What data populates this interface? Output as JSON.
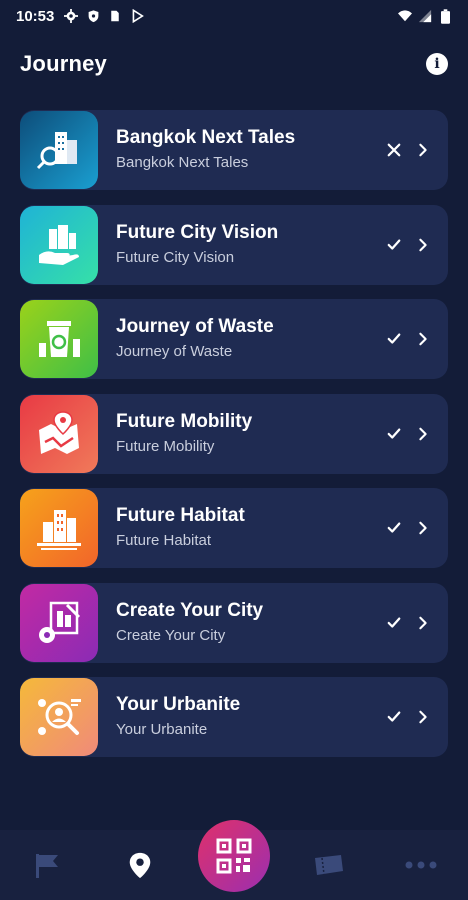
{
  "status_bar": {
    "time": "10:53",
    "icons_left": [
      "settings-icon",
      "shield-icon",
      "sim-icon",
      "play-store-icon"
    ],
    "icons_right": [
      "wifi-icon",
      "signal-icon",
      "battery-icon"
    ]
  },
  "header": {
    "title": "Journey",
    "info_icon": "info-icon"
  },
  "journeys": [
    {
      "title": "Bangkok Next Tales",
      "subtitle": "Bangkok Next Tales",
      "status": "incomplete",
      "status_icon": "close-icon",
      "color_from": "#0d4d7a",
      "color_to": "#1a9fd1"
    },
    {
      "title": "Future City Vision",
      "subtitle": "Future City Vision",
      "status": "complete",
      "status_icon": "check-icon",
      "color_from": "#1fb3d6",
      "color_to": "#36e0a8"
    },
    {
      "title": "Journey of Waste",
      "subtitle": "Journey of Waste",
      "status": "complete",
      "status_icon": "check-icon",
      "color_from": "#9bd21a",
      "color_to": "#3fbf47"
    },
    {
      "title": "Future Mobility",
      "subtitle": "Future Mobility",
      "status": "complete",
      "status_icon": "check-icon",
      "color_from": "#e83a44",
      "color_to": "#f07a5a"
    },
    {
      "title": "Future Habitat",
      "subtitle": "Future Habitat",
      "status": "complete",
      "status_icon": "check-icon",
      "color_from": "#f6a21b",
      "color_to": "#f2652a"
    },
    {
      "title": "Create Your City",
      "subtitle": "Create Your City",
      "status": "complete",
      "status_icon": "check-icon",
      "color_from": "#c22aa3",
      "color_to": "#8b2bb5"
    },
    {
      "title": "Your Urbanite",
      "subtitle": "Your Urbanite",
      "status": "complete",
      "status_icon": "check-icon",
      "color_from": "#f5b93a",
      "color_to": "#f08a7a"
    }
  ],
  "bottom_nav": {
    "items": [
      "flag-icon",
      "location-pin-icon",
      "qr-code-icon",
      "ticket-icon",
      "more-icon"
    ],
    "active": "location-pin-icon"
  },
  "colors": {
    "background": "#131c38",
    "card": "#1f2b52",
    "nav": "#18213f",
    "inactive_icon": "#3a4a7a"
  }
}
